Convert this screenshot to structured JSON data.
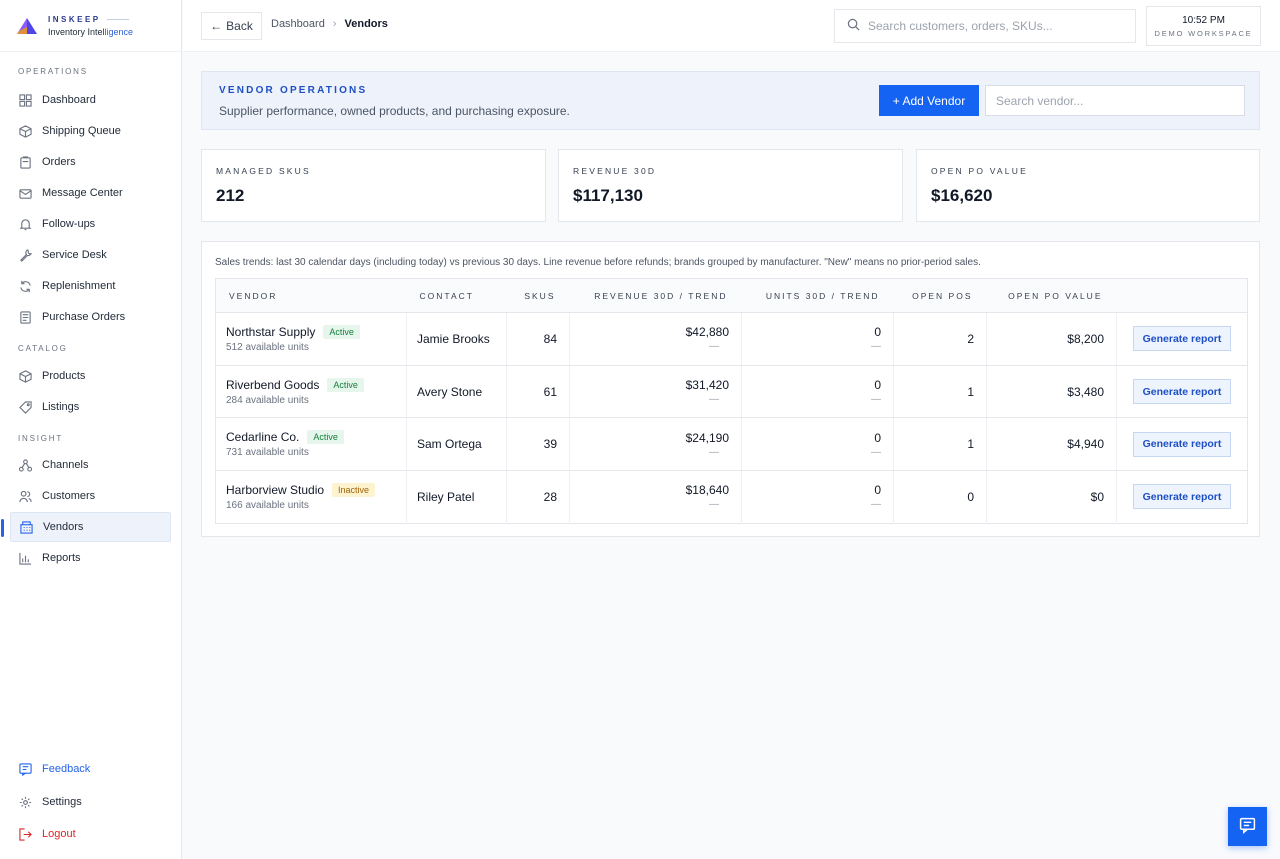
{
  "brand": {
    "name_top": "INSKEEP",
    "name_bottom_a": "Inventory Intel",
    "name_bottom_b": "ligence"
  },
  "sidebar": {
    "sections": [
      {
        "label": "OPERATIONS",
        "items": [
          {
            "label": "Dashboard",
            "icon": "grid-icon"
          },
          {
            "label": "Shipping Queue",
            "icon": "package-icon"
          },
          {
            "label": "Orders",
            "icon": "clipboard-icon"
          },
          {
            "label": "Message Center",
            "icon": "mail-icon"
          },
          {
            "label": "Follow-ups",
            "icon": "bell-icon"
          },
          {
            "label": "Service Desk",
            "icon": "wrench-icon"
          },
          {
            "label": "Replenishment",
            "icon": "refresh-icon"
          },
          {
            "label": "Purchase Orders",
            "icon": "document-icon"
          }
        ]
      },
      {
        "label": "CATALOG",
        "items": [
          {
            "label": "Products",
            "icon": "box-icon"
          },
          {
            "label": "Listings",
            "icon": "tag-icon"
          }
        ]
      },
      {
        "label": "INSIGHT",
        "items": [
          {
            "label": "Channels",
            "icon": "network-icon"
          },
          {
            "label": "Customers",
            "icon": "users-icon"
          },
          {
            "label": "Vendors",
            "icon": "building-icon",
            "active": true
          },
          {
            "label": "Reports",
            "icon": "bar-chart-icon"
          }
        ]
      }
    ],
    "footer": [
      {
        "label": "Feedback",
        "icon": "feedback-icon"
      },
      {
        "label": "Settings",
        "icon": "gear-icon"
      },
      {
        "label": "Logout",
        "icon": "logout-icon"
      }
    ]
  },
  "topbar": {
    "back_label": "Back",
    "breadcrumb": [
      "Dashboard",
      "Vendors"
    ],
    "search_placeholder": "Search customers, orders, SKUs...",
    "time": "10:52 PM",
    "workspace": "DEMO WORKSPACE"
  },
  "header": {
    "title": "VENDOR OPERATIONS",
    "subtitle": "Supplier performance, owned products, and purchasing exposure.",
    "add_button": "+ Add Vendor",
    "search_placeholder": "Search vendor..."
  },
  "stats": [
    {
      "label": "MANAGED SKUS",
      "value": "212"
    },
    {
      "label": "REVENUE 30D",
      "value": "$117,130"
    },
    {
      "label": "OPEN PO VALUE",
      "value": "$16,620"
    }
  ],
  "table": {
    "note": "Sales trends: last 30 calendar days (including today) vs previous 30 days. Line revenue before refunds; brands grouped by manufacturer. \"New\" means no prior-period sales.",
    "columns": [
      "VENDOR",
      "CONTACT",
      "SKUS",
      "REVENUE 30D / TREND",
      "UNITS 30D / TREND",
      "OPEN POS",
      "OPEN PO VALUE",
      ""
    ],
    "rows": [
      {
        "vendor": "Northstar Supply",
        "status": "Active",
        "units_avail": "512 available units",
        "contact": "Jamie Brooks",
        "skus": "84",
        "revenue": "$42,880",
        "revenue_trend": "—",
        "units": "0",
        "units_trend": "—",
        "open_pos": "2",
        "open_po_value": "$8,200",
        "action": "Generate report"
      },
      {
        "vendor": "Riverbend Goods",
        "status": "Active",
        "units_avail": "284 available units",
        "contact": "Avery Stone",
        "skus": "61",
        "revenue": "$31,420",
        "revenue_trend": "—",
        "units": "0",
        "units_trend": "—",
        "open_pos": "1",
        "open_po_value": "$3,480",
        "action": "Generate report"
      },
      {
        "vendor": "Cedarline Co.",
        "status": "Active",
        "units_avail": "731 available units",
        "contact": "Sam Ortega",
        "skus": "39",
        "revenue": "$24,190",
        "revenue_trend": "—",
        "units": "0",
        "units_trend": "—",
        "open_pos": "1",
        "open_po_value": "$4,940",
        "action": "Generate report"
      },
      {
        "vendor": "Harborview Studio",
        "status": "Inactive",
        "units_avail": "166 available units",
        "contact": "Riley Patel",
        "skus": "28",
        "revenue": "$18,640",
        "revenue_trend": "—",
        "units": "0",
        "units_trend": "—",
        "open_pos": "0",
        "open_po_value": "$0",
        "action": "Generate report"
      }
    ]
  },
  "colors": {
    "accent": "#1463f3",
    "active_badge": "#15803d",
    "inactive_badge": "#a16207",
    "logout": "#dc2626"
  }
}
